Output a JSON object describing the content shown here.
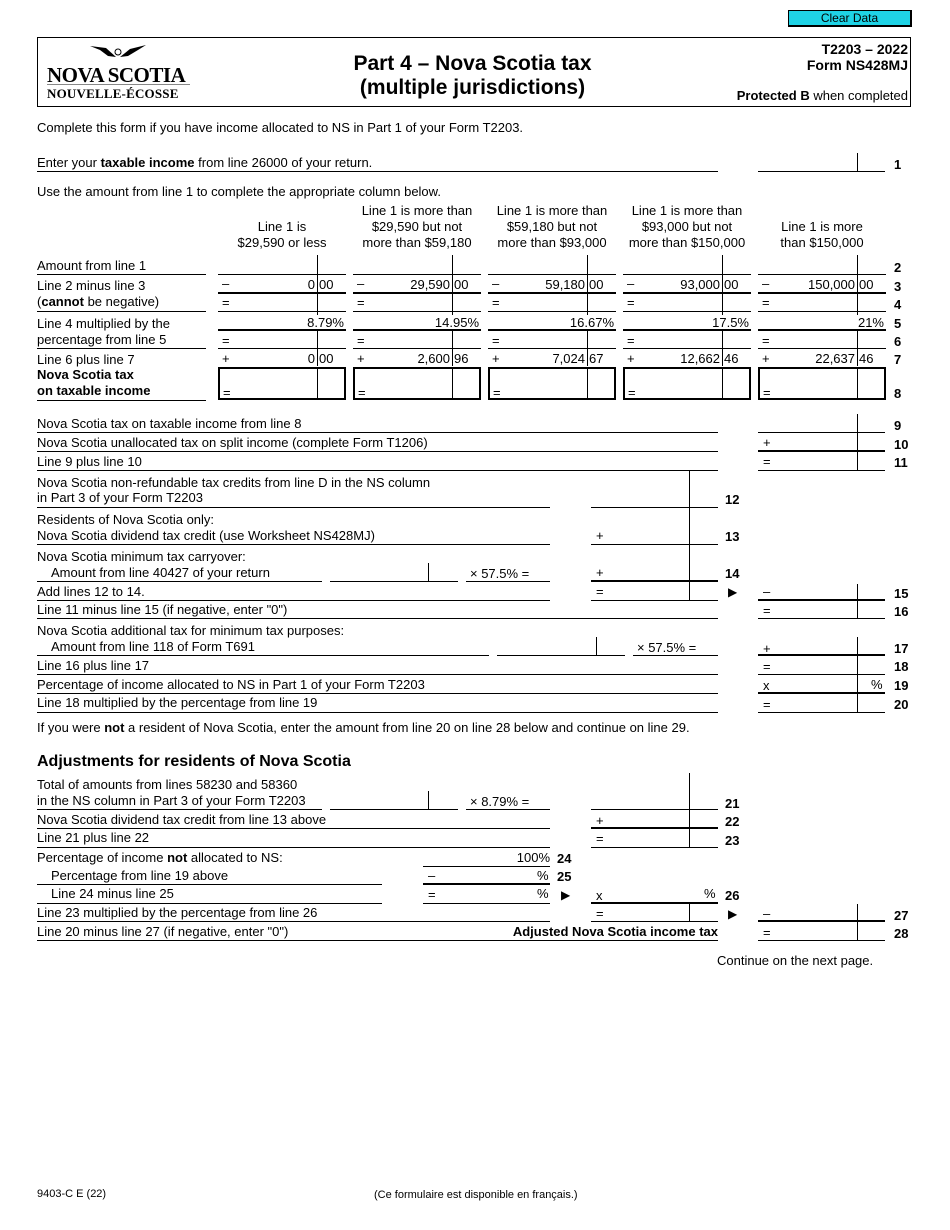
{
  "toolbar": {
    "clear_data_label": "Clear Data"
  },
  "header": {
    "logo_line1": "NOVA SCOTIA",
    "logo_line2": "NOUVELLE-ÉCOSSE",
    "title_line1": "Part 4 – Nova Scotia tax",
    "title_line2": "(multiple jurisdictions)",
    "form_id_line1": "T2203 – 2022",
    "form_id_line2": "Form NS428MJ",
    "protected_bold": "Protected B",
    "protected_rest": " when completed"
  },
  "intro": "Complete this form if you have income allocated to NS in Part 1 of your Form T2203.",
  "line1": {
    "text_pre": "Enter your ",
    "text_bold": "taxable income",
    "text_post": " from line 26000 of your return.",
    "number": "1",
    "value": ""
  },
  "columns_intro": "Use the amount from line 1 to complete the appropriate column below.",
  "column_headers": [
    [
      "Line 1 is",
      "$29,590 or less"
    ],
    [
      "Line 1 is more than",
      "$29,590 but not",
      "more than $59,180"
    ],
    [
      "Line 1 is more than",
      "$59,180 but not",
      "more than $93,000"
    ],
    [
      "Line 1 is more than",
      "$93,000 but not",
      "more than $150,000"
    ],
    [
      "Line 1 is more",
      "than $150,000"
    ]
  ],
  "table_rows": {
    "row2": {
      "label": "Amount from line 1",
      "number": "2"
    },
    "row3": {
      "label": "Line 2 minus line 3",
      "number": "3"
    },
    "row4": {
      "label_pre": "(",
      "label_bold": "cannot",
      "label_post": " be negative)",
      "number": "4"
    },
    "row5": {
      "label": "Line 4 multiplied by the",
      "number": "5"
    },
    "row6": {
      "label": "percentage from line 5",
      "number": "6"
    },
    "row7": {
      "label": "Line 6 plus line 7",
      "number": "7"
    },
    "row8": {
      "label_line1": "Nova Scotia tax",
      "label_line2": "on taxable income",
      "number": "8"
    }
  },
  "columns": [
    {
      "line3_dollars": "0",
      "line3_cents": "00",
      "rate": "8.79%",
      "line7_dollars": "0",
      "line7_cents": "00"
    },
    {
      "line3_dollars": "29,590",
      "line3_cents": "00",
      "rate": "14.95%",
      "line7_dollars": "2,600",
      "line7_cents": "96"
    },
    {
      "line3_dollars": "59,180",
      "line3_cents": "00",
      "rate": "16.67%",
      "line7_dollars": "7,024",
      "line7_cents": "67"
    },
    {
      "line3_dollars": "93,000",
      "line3_cents": "00",
      "rate": "17.5%",
      "line7_dollars": "12,662",
      "line7_cents": "46"
    },
    {
      "line3_dollars": "150,000",
      "line3_cents": "00",
      "rate": "21%",
      "line7_dollars": "22,637",
      "line7_cents": "46"
    }
  ],
  "operators": {
    "minus": "–",
    "equals": "=",
    "times": "×",
    "plus": "+",
    "times_x": "x",
    "arrow": "▶",
    "percent": "%"
  },
  "lines": {
    "l9": {
      "label": "Nova Scotia tax on taxable income from line 8",
      "number": "9"
    },
    "l10": {
      "label": "Nova Scotia unallocated tax on split income (complete Form T1206)",
      "number": "10"
    },
    "l11": {
      "label": "Line 9 plus line 10",
      "number": "11"
    },
    "l12": {
      "label_line1": "Nova Scotia non-refundable tax credits from line D in the NS column",
      "label_line2": "in Part 3 of your Form T2203",
      "number": "12"
    },
    "l13": {
      "label_line1": "Residents of Nova Scotia only:",
      "label_line2": "Nova Scotia dividend tax credit (use Worksheet NS428MJ)",
      "number": "13"
    },
    "l14": {
      "label_line1": "Nova Scotia minimum tax carryover:",
      "label_line2": "Amount from line 40427 of your return",
      "rate": "× 57.5% =",
      "number": "14"
    },
    "l15": {
      "label": "Add lines 12 to 14.",
      "number": "15"
    },
    "l16": {
      "label": "Line 11 minus line 15 (if negative, enter \"0\")",
      "number": "16"
    },
    "l17": {
      "label_line1": "Nova Scotia additional tax for minimum tax purposes:",
      "label_line2": "Amount from line 118 of Form T691",
      "rate": "× 57.5% =",
      "number": "17"
    },
    "l18": {
      "label": "Line 16 plus line 17",
      "number": "18"
    },
    "l19": {
      "label": "Percentage of income allocated to NS in Part 1 of your Form T2203",
      "number": "19"
    },
    "l20": {
      "label": "Line 18 multiplied by the percentage from line 19",
      "number": "20"
    }
  },
  "nonresident_note": {
    "pre": "If you were ",
    "bold": "not",
    "post": " a resident of Nova Scotia, enter the amount from line 20 on line 28 below and continue on line 29."
  },
  "adjustments": {
    "heading": "Adjustments for residents of Nova Scotia",
    "l21": {
      "label_line1": "Total of amounts from lines 58230 and 58360",
      "label_line2": "in the NS column in Part 3 of your Form T2203",
      "rate": "× 8.79% =",
      "number": "21"
    },
    "l22": {
      "label": "Nova Scotia dividend tax credit from line 13 above",
      "number": "22"
    },
    "l23": {
      "label": "Line 21 plus line 22",
      "number": "23"
    },
    "l24": {
      "label_pre": "Percentage of income ",
      "label_bold": "not",
      "label_post": " allocated to NS:",
      "value": "100%",
      "number": "24"
    },
    "l25": {
      "label": "Percentage from line 19 above",
      "number": "25"
    },
    "l26": {
      "label": "Line 24 minus line 25",
      "number": "26"
    },
    "l27": {
      "label": "Line 23 multiplied by the percentage from line 26",
      "number": "27"
    },
    "l28": {
      "label": "Line 20 minus line 27 (if negative, enter \"0\")",
      "result_label": "Adjusted Nova Scotia income tax",
      "number": "28"
    }
  },
  "continue_note": "Continue on the next page.",
  "footer": {
    "form_code": "9403-C E (22)",
    "french_note": "(Ce formulaire est disponible en français.)"
  }
}
